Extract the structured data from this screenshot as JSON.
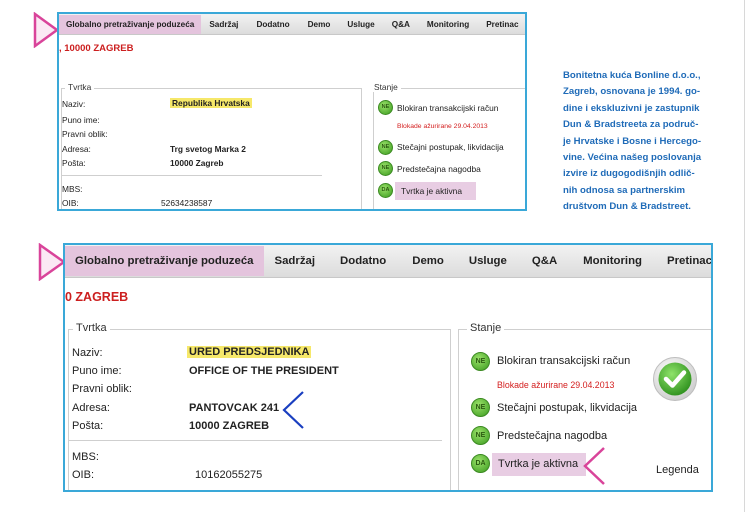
{
  "nav_tabs": [
    "Globalno pretraživanje poduzeća",
    "Sadržaj",
    "Dodatno",
    "Demo",
    "Usluge",
    "Q&A",
    "Monitoring",
    "Pretinac"
  ],
  "top": {
    "city": ", 10000 ZAGREB",
    "company_group_label": "Tvrtka",
    "status_group_label": "Stanje",
    "fields": {
      "naziv_label": "Naziv:",
      "naziv_value": "Republika Hrvatska",
      "puno_ime_label": "Puno ime:",
      "pravni_oblik_label": "Pravni oblik:",
      "adresa_label": "Adresa:",
      "adresa_value": "Trg svetog Marka 2",
      "posta_label": "Pošta:",
      "posta_value": "10000 Zagreb",
      "mbs_label": "MBS:",
      "oib_label": "OIB:",
      "oib_value": "52634238587"
    },
    "status": {
      "ne1": "NE",
      "blokiran": "Blokiran transakcijski račun",
      "blokade_note": "Blokade ažurirane 29.04.2013",
      "ne2": "NE",
      "stecajni": "Stečajni postupak, likvidacija",
      "ne3": "NE",
      "predstecajna": "Predstečajna nagodba",
      "da": "DA",
      "aktivna": "Tvrtka je aktivna"
    }
  },
  "bottom": {
    "city": "0 ZAGREB",
    "company_group_label": "Tvrtka",
    "status_group_label": "Stanje",
    "fields": {
      "naziv_label": "Naziv:",
      "naziv_value": "URED PREDSJEDNIKA",
      "puno_ime_label": "Puno ime:",
      "puno_ime_value": "OFFICE OF THE PRESIDENT",
      "pravni_oblik_label": "Pravni oblik:",
      "adresa_label": "Adresa:",
      "adresa_value": "PANTOVCAK 241",
      "posta_label": "Pošta:",
      "posta_value": "10000 ZAGREB",
      "mbs_label": "MBS:",
      "oib_label": "OIB:",
      "oib_value": "10162055275"
    },
    "status": {
      "ne1": "NE",
      "blokiran": "Blokiran transakcijski račun",
      "blokade_note": "Blokade ažurirane 29.04.2013",
      "ne2": "NE",
      "stecajni": "Stečajni postupak, likvidacija",
      "ne3": "NE",
      "predstecajna": "Predstečajna nagodba",
      "da": "DA",
      "aktivna": "Tvrtka je aktivna",
      "legenda": "Legenda"
    }
  },
  "description": [
    "Bonitetna kuća Bonline d.o.o.,",
    "Zagreb, osnovana je 1994. go-",
    "dine i ekskluzivni je zastupnik",
    "Dun & Bradstreeta za područ-",
    "je Hrvatske i Bosne i Hercego-",
    "vine. Većina našeg poslovanja",
    "izvire iz dugogodišnjih odlič-",
    "nih odnosa sa partnerskim",
    "društvom Dun & Bradstreet."
  ],
  "colors": {
    "accent_border": "#3aa8d8",
    "active_tab": "#e4c4dd",
    "arrow_pink": "#d9449a",
    "arrow_blue": "#1a3fc0",
    "city_red": "#cc1f1f",
    "description_blue": "#1f6bb8"
  },
  "icons": [
    "arrow-right-pink",
    "arrow-left-blue",
    "arrow-left-pink",
    "green-check-icon"
  ]
}
